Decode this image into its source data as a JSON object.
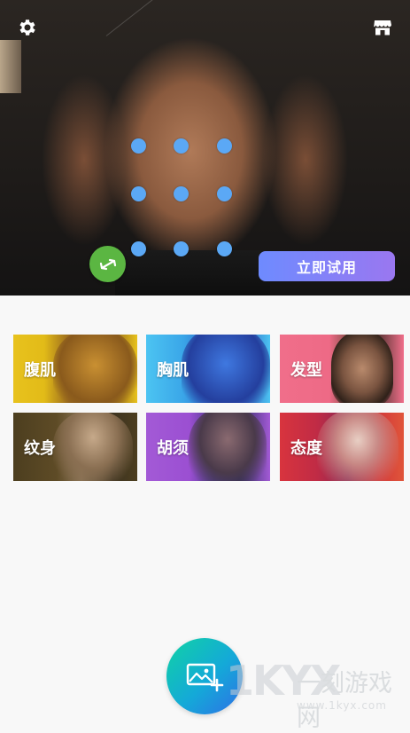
{
  "hero": {
    "try_button_label": "立即试用"
  },
  "categories": [
    {
      "label": "腹肌"
    },
    {
      "label": "胸肌"
    },
    {
      "label": "发型"
    },
    {
      "label": "纹身"
    },
    {
      "label": "胡须"
    },
    {
      "label": "态度"
    }
  ],
  "watermark": {
    "logo": "1KYX",
    "text": "一刻游戏网",
    "url": "www.1kyx.com"
  },
  "colors": {
    "accent_gradient": [
      "#6e8bff",
      "#9a77f0"
    ],
    "fab_gradient": [
      "#10d3a4",
      "#2f6fe6"
    ],
    "dot": "#5ba8f5",
    "swap_button": "#5bb642"
  },
  "icons": {
    "top_left": "gear-icon",
    "top_right": "store-icon",
    "swap": "swap-arrows-icon",
    "fab": "add-photo-icon"
  }
}
